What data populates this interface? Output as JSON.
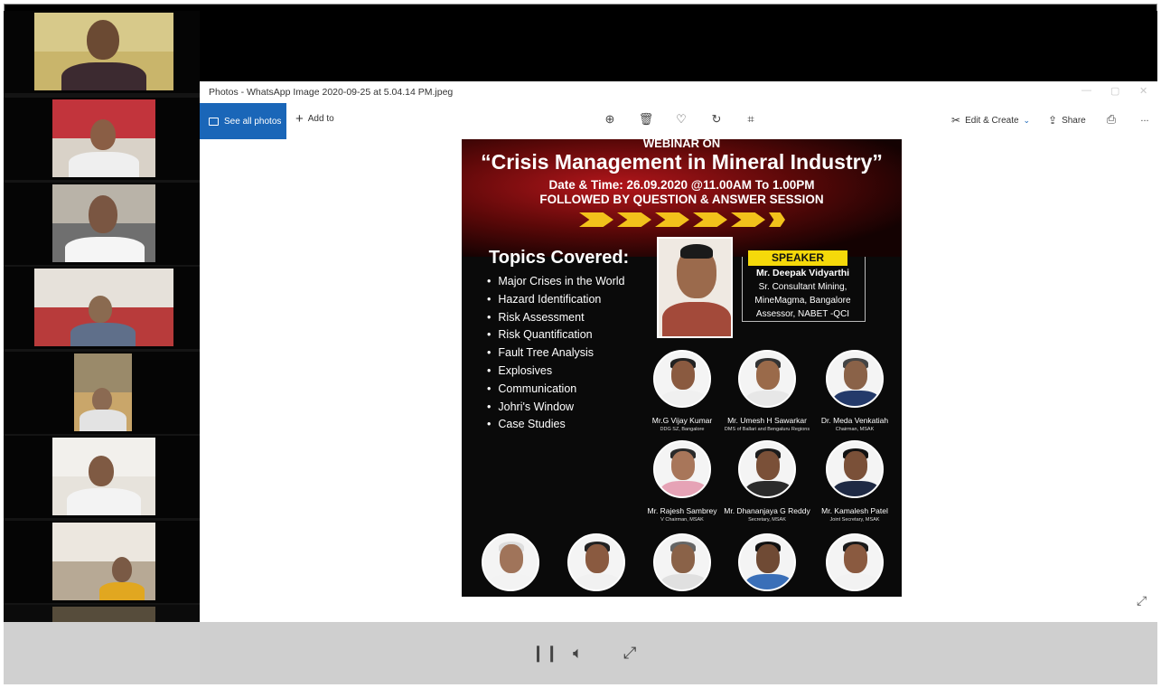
{
  "window": {
    "title": "Photos - WhatsApp Image 2020-09-25 at 5.04.14 PM.jpeg",
    "controls": [
      "—",
      "▢",
      "✕"
    ]
  },
  "toolbar": {
    "see_all_label": "See all photos",
    "add_to_label": "Add to",
    "edit_create_label": "Edit & Create",
    "share_label": "Share",
    "more_label": "..."
  },
  "poster": {
    "line1": "WEBINAR ON",
    "line2": "“Crisis Management in Mineral Industry”",
    "line3": "Date & Time: 26.09.2020 @11.00AM To 1.00PM",
    "line4": "FOLLOWED BY QUESTION & ANSWER SESSION",
    "topics_heading": "Topics Covered:",
    "topics": [
      "Major Crises in the World",
      "Hazard Identification",
      " Risk Assessment",
      "Risk Quantification",
      "Fault Tree Analysis",
      "Explosives",
      "Communication",
      "Johri's Window",
      "Case Studies"
    ],
    "speaker_label": "SPEAKER",
    "speaker_name": "Mr. Deepak Vidyarthi",
    "speaker_lines": [
      "Sr. Consultant Mining,",
      "MineMagma, Bangalore",
      "Assessor, NABET -QCI"
    ],
    "panel": [
      {
        "name": "Mr.G Vijay Kumar",
        "role": "DDG SZ, Bangalore"
      },
      {
        "name": "Mr. Umesh H Sawarkar",
        "role": "DMS of Ballari and Bengaluru Regions"
      },
      {
        "name": "Dr. Meda Venkatiah",
        "role": "Chairman, MSAK"
      },
      {
        "name": "Mr. Rajesh Sambrey",
        "role": "V Chairman, MSAK"
      },
      {
        "name": "Mr. Dhananjaya G Reddy",
        "role": "Secretary, MSAK"
      },
      {
        "name": "Mr. Kamalesh Patel",
        "role": "Joint Secretary, MSAK"
      }
    ]
  },
  "colors": {
    "accent_blue": "#1a66b8",
    "poster_yellow": "#f5d90a",
    "poster_red": "#b3161b"
  },
  "icons": {
    "zoom": "zoom-in-icon",
    "delete": "trash-icon",
    "favorite": "heart-icon",
    "rotate": "rotate-icon",
    "crop": "crop-icon",
    "print": "print-icon"
  }
}
